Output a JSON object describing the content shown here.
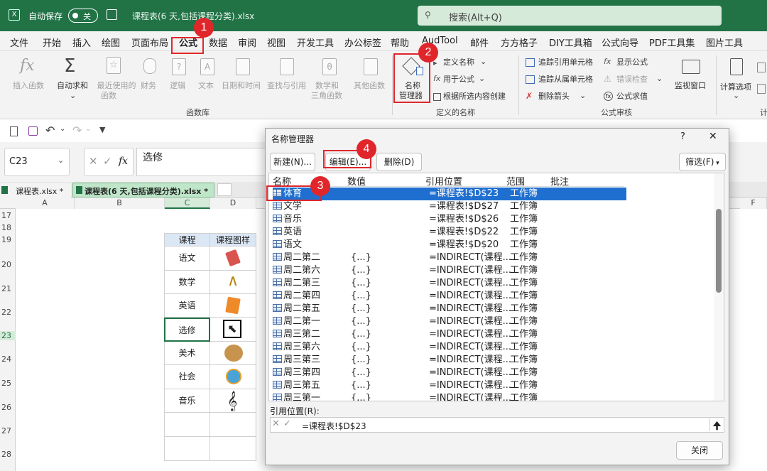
{
  "titlebar": {
    "autosave_label": "自动保存",
    "autosave_state": "关",
    "filename": "课程表(6 天,包括课程分类).xlsx",
    "search_placeholder": "搜索(Alt+Q)"
  },
  "menu": [
    "文件",
    "开始",
    "插入",
    "绘图",
    "页面布局",
    "公式",
    "数据",
    "审阅",
    "视图",
    "开发工具",
    "办公标签",
    "帮助",
    "AudTool",
    "邮件",
    "方方格子",
    "DIY工具箱",
    "公式向导",
    "PDF工具集",
    "图片工具"
  ],
  "ribbon": {
    "insert_function": "插入函数",
    "autosum": "自动求和",
    "recent": [
      "最近使用的",
      "函数"
    ],
    "finance": "财务",
    "logic": "逻辑",
    "text": "文本",
    "datetime": "日期和时间",
    "lookup": "查找与引用",
    "math": [
      "数学和",
      "三角函数"
    ],
    "more": "其他函数",
    "library_label": "函数库",
    "name_manager": [
      "名称",
      "管理器"
    ],
    "define_name": "定义名称",
    "use_in_formula": "用于公式",
    "create_from_selection": "根据所选内容创建",
    "defined_names_label": "定义的名称",
    "trace_precedents": "追踪引用单元格",
    "trace_dependents": "追踪从属单元格",
    "remove_arrows": "删除箭头",
    "show_formulas": "显示公式",
    "error_checking": "错误检查",
    "evaluate_formula": "公式求值",
    "watch_window": "监视窗口",
    "audit_label": "公式审核",
    "calc_options": "计算选项",
    "calc_label": "计"
  },
  "formula_bar": {
    "cell_ref": "C23",
    "fx": "fx",
    "value": "选修"
  },
  "tabs": [
    "课程表.xlsx *",
    "课程表(6 天,包括课程分类).xlsx *"
  ],
  "sheet": {
    "columns": [
      "A",
      "B",
      "C",
      "D",
      "F"
    ],
    "row_numbers": [
      "17",
      "18",
      "19",
      "20",
      "21",
      "22",
      "23",
      "24",
      "25",
      "26",
      "27",
      "28"
    ],
    "header": [
      "课程",
      "课程图样"
    ],
    "courses": [
      "语文",
      "数学",
      "英语",
      "选修",
      "美术",
      "社会",
      "音乐"
    ]
  },
  "dialog": {
    "title": "名称管理器",
    "help": "?",
    "close": "✕",
    "btn_new": "新建(N)...",
    "btn_edit": "编辑(E)...",
    "btn_delete": "删除(D)",
    "btn_filter": "筛选(F)",
    "columns": [
      "名称",
      "数值",
      "引用位置",
      "范围",
      "批注"
    ],
    "rows": [
      {
        "name": "体育",
        "value": "",
        "ref": "=课程表!$D$23",
        "scope": "工作簿"
      },
      {
        "name": "文学",
        "value": "",
        "ref": "=课程表!$D$27",
        "scope": "工作簿"
      },
      {
        "name": "音乐",
        "value": "",
        "ref": "=课程表!$D$26",
        "scope": "工作簿"
      },
      {
        "name": "英语",
        "value": "",
        "ref": "=课程表!$D$22",
        "scope": "工作簿"
      },
      {
        "name": "语文",
        "value": "",
        "ref": "=课程表!$D$20",
        "scope": "工作簿"
      },
      {
        "name": "周二第二",
        "value": "{...}",
        "ref": "=INDIRECT(课程...",
        "scope": "工作簿"
      },
      {
        "name": "周二第六",
        "value": "{...}",
        "ref": "=INDIRECT(课程...",
        "scope": "工作簿"
      },
      {
        "name": "周二第三",
        "value": "{...}",
        "ref": "=INDIRECT(课程...",
        "scope": "工作簿"
      },
      {
        "name": "周二第四",
        "value": "{...}",
        "ref": "=INDIRECT(课程...",
        "scope": "工作簿"
      },
      {
        "name": "周二第五",
        "value": "{...}",
        "ref": "=INDIRECT(课程...",
        "scope": "工作簿"
      },
      {
        "name": "周二第一",
        "value": "{...}",
        "ref": "=INDIRECT(课程...",
        "scope": "工作簿"
      },
      {
        "name": "周三第二",
        "value": "{...}",
        "ref": "=INDIRECT(课程...",
        "scope": "工作簿"
      },
      {
        "name": "周三第六",
        "value": "{...}",
        "ref": "=INDIRECT(课程...",
        "scope": "工作簿"
      },
      {
        "name": "周三第三",
        "value": "{...}",
        "ref": "=INDIRECT(课程...",
        "scope": "工作簿"
      },
      {
        "name": "周三第四",
        "value": "{...}",
        "ref": "=INDIRECT(课程...",
        "scope": "工作簿"
      },
      {
        "name": "周三第五",
        "value": "{...}",
        "ref": "=INDIRECT(课程...",
        "scope": "工作簿"
      },
      {
        "name": "周三第一",
        "value": "{...}",
        "ref": "=INDIRECT(课程...",
        "scope": "工作簿"
      }
    ],
    "refers_to_label": "引用位置(R):",
    "refers_to_value": "=课程表!$D$23",
    "btn_close": "关闭"
  },
  "badges": [
    "1",
    "2",
    "3",
    "4"
  ],
  "colors": {
    "excel_green": "#217346",
    "selection_blue": "#1f6fd0",
    "callout_red": "#e0262b"
  }
}
